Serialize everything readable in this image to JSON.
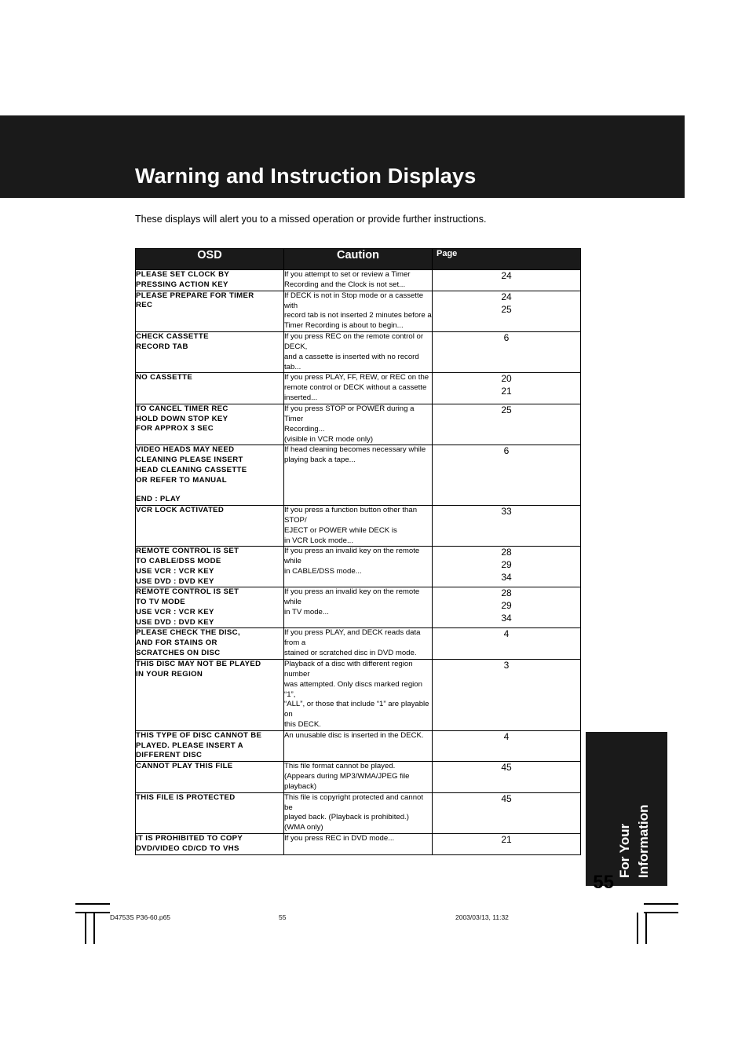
{
  "header": {
    "title": "Warning and Instruction Displays"
  },
  "intro": "These displays will alert you to a missed operation or provide further instructions.",
  "table": {
    "headers": {
      "osd": "OSD",
      "caution": "Caution",
      "page": "Page"
    },
    "rows": [
      {
        "osd": [
          "PLEASE SET CLOCK BY",
          "PRESSING ACTION KEY"
        ],
        "caution": [
          "If you attempt to set or review a Timer",
          "Recording and the Clock is not set..."
        ],
        "page": [
          "24"
        ]
      },
      {
        "osd": [
          "PLEASE PREPARE FOR TIMER",
          "REC"
        ],
        "caution": [
          "If DECK is not in Stop mode or a cassette with",
          "record tab is not inserted 2 minutes before a",
          "Timer Recording is about to begin..."
        ],
        "page": [
          "24",
          "25"
        ]
      },
      {
        "osd": [
          "CHECK CASSETTE",
          "RECORD TAB"
        ],
        "caution": [
          "If you press REC on the remote control or DECK,",
          "and a cassette is inserted with no record tab..."
        ],
        "page": [
          "6"
        ]
      },
      {
        "osd": [
          "NO CASSETTE"
        ],
        "caution": [
          "If you press PLAY, FF, REW, or REC on the",
          "remote control or DECK without a cassette",
          "inserted..."
        ],
        "page": [
          "20",
          "21"
        ]
      },
      {
        "osd": [
          "TO CANCEL TIMER REC",
          "HOLD DOWN STOP KEY",
          "FOR APPROX 3 SEC"
        ],
        "caution": [
          "If you press STOP or POWER during a Timer",
          "Recording...",
          "(visible in VCR mode only)"
        ],
        "page": [
          "25"
        ]
      },
      {
        "osd": [
          "VIDEO HEADS MAY NEED",
          "CLEANING PLEASE INSERT",
          "HEAD CLEANING CASSETTE",
          "OR REFER TO MANUAL"
        ],
        "osd_extra": "END         : PLAY",
        "caution": [
          "If head cleaning becomes necessary while",
          "playing back a tape..."
        ],
        "page": [
          "6"
        ]
      },
      {
        "osd": [
          "VCR LOCK ACTIVATED"
        ],
        "caution": [
          "If you press a function button other than STOP/",
          "EJECT or POWER while DECK is",
          "in VCR Lock mode..."
        ],
        "page": [
          "33"
        ]
      },
      {
        "osd": [
          "REMOTE CONTROL IS SET",
          "TO CABLE/DSS MODE",
          "USE VCR : VCR KEY",
          "USE DVD : DVD KEY"
        ],
        "caution": [
          "If you press an invalid key on the remote while",
          "in CABLE/DSS mode..."
        ],
        "page": [
          "28",
          "29",
          "34"
        ]
      },
      {
        "osd": [
          "REMOTE CONTROL IS SET",
          "TO TV MODE",
          "USE VCR : VCR KEY",
          "USE DVD : DVD KEY"
        ],
        "caution": [
          "If you press an invalid key on the remote while",
          "in TV mode..."
        ],
        "page": [
          "28",
          "29",
          "34"
        ]
      },
      {
        "osd": [
          "PLEASE CHECK THE DISC,",
          "AND FOR STAINS OR",
          "SCRATCHES ON DISC"
        ],
        "caution": [
          "If you press PLAY, and DECK reads data from a",
          "stained or scratched disc in DVD mode."
        ],
        "page": [
          "4"
        ]
      },
      {
        "osd": [
          "THIS DISC MAY NOT BE PLAYED",
          "IN YOUR REGION"
        ],
        "caution": [
          "Playback of a disc with different region number",
          "was attempted. Only discs marked region “1”,",
          "“ALL”, or those that include “1” are playable on",
          "this DECK."
        ],
        "page": [
          "3"
        ]
      },
      {
        "osd": [
          "THIS TYPE OF DISC CANNOT BE",
          "PLAYED. PLEASE INSERT A",
          "DIFFERENT  DISC"
        ],
        "caution": [
          "An unusable disc is inserted in the DECK."
        ],
        "page": [
          "4"
        ]
      },
      {
        "osd": [
          "CANNOT PLAY THIS FILE"
        ],
        "caution": [
          "This file format cannot be played.",
          "(Appears during MP3/WMA/JPEG file playback)"
        ],
        "page": [
          "45"
        ]
      },
      {
        "osd": [
          "THIS FILE IS PROTECTED"
        ],
        "caution": [
          "This file is copyright protected and cannot be",
          "played back. (Playback is prohibited.)",
          "(WMA only)"
        ],
        "page": [
          "45"
        ]
      },
      {
        "osd": [
          "IT IS PROHIBITED TO COPY",
          "DVD/VIDEO CD/CD TO VHS"
        ],
        "caution": [
          "If you press REC in DVD mode..."
        ],
        "page": [
          "21"
        ]
      }
    ]
  },
  "side_tab": {
    "line1": "For Your",
    "line2": "Information"
  },
  "page_number": "55",
  "footer": {
    "file": "D4753S P36-60.p65",
    "page": "55",
    "timestamp": "2003/03/13, 11:32"
  }
}
